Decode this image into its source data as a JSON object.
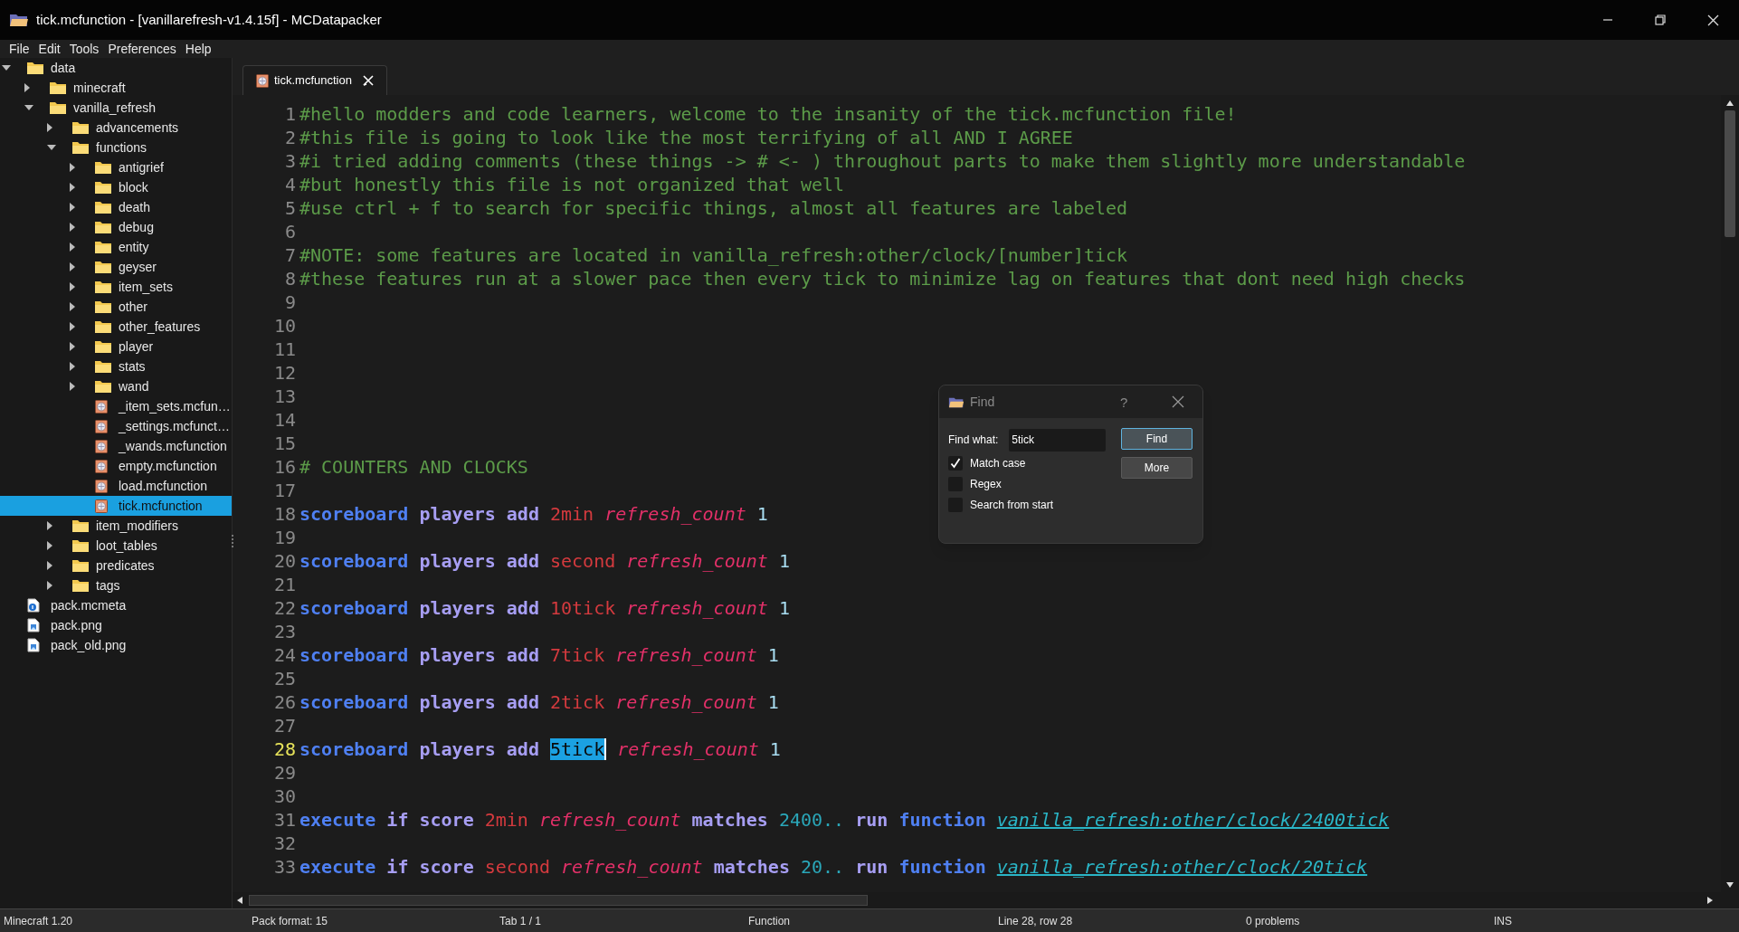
{
  "window": {
    "title": "tick.mcfunction - [vanillarefresh-v1.4.15f] - MCDatapacker"
  },
  "menu": [
    "File",
    "Edit",
    "Tools",
    "Preferences",
    "Help"
  ],
  "tree": [
    {
      "label": "data",
      "kind": "folder",
      "expanded": true,
      "selected": false,
      "children": [
        {
          "label": "minecraft",
          "kind": "folder",
          "expanded": false,
          "selected": false
        },
        {
          "label": "vanilla_refresh",
          "kind": "folder",
          "expanded": true,
          "selected": false,
          "children": [
            {
              "label": "advancements",
              "kind": "folder",
              "expanded": false,
              "selected": false
            },
            {
              "label": "functions",
              "kind": "folder",
              "expanded": true,
              "selected": false,
              "children": [
                {
                  "label": "antigrief",
                  "kind": "folder",
                  "expanded": false,
                  "selected": false
                },
                {
                  "label": "block",
                  "kind": "folder",
                  "expanded": false,
                  "selected": false
                },
                {
                  "label": "death",
                  "kind": "folder",
                  "expanded": false,
                  "selected": false
                },
                {
                  "label": "debug",
                  "kind": "folder",
                  "expanded": false,
                  "selected": false
                },
                {
                  "label": "entity",
                  "kind": "folder",
                  "expanded": false,
                  "selected": false
                },
                {
                  "label": "geyser",
                  "kind": "folder",
                  "expanded": false,
                  "selected": false
                },
                {
                  "label": "item_sets",
                  "kind": "folder",
                  "expanded": false,
                  "selected": false
                },
                {
                  "label": "other",
                  "kind": "folder",
                  "expanded": false,
                  "selected": false
                },
                {
                  "label": "other_features",
                  "kind": "folder",
                  "expanded": false,
                  "selected": false
                },
                {
                  "label": "player",
                  "kind": "folder",
                  "expanded": false,
                  "selected": false
                },
                {
                  "label": "stats",
                  "kind": "folder",
                  "expanded": false,
                  "selected": false
                },
                {
                  "label": "wand",
                  "kind": "folder",
                  "expanded": false,
                  "selected": false
                },
                {
                  "label": "_item_sets.mcfun…",
                  "kind": "function",
                  "selected": false
                },
                {
                  "label": "_settings.mcfunct…",
                  "kind": "function",
                  "selected": false
                },
                {
                  "label": "_wands.mcfunction",
                  "kind": "function",
                  "selected": false
                },
                {
                  "label": "empty.mcfunction",
                  "kind": "function",
                  "selected": false
                },
                {
                  "label": "load.mcfunction",
                  "kind": "function",
                  "selected": false
                },
                {
                  "label": "tick.mcfunction",
                  "kind": "function",
                  "selected": true
                }
              ]
            },
            {
              "label": "item_modifiers",
              "kind": "folder",
              "expanded": false,
              "selected": false
            },
            {
              "label": "loot_tables",
              "kind": "folder",
              "expanded": false,
              "selected": false
            },
            {
              "label": "predicates",
              "kind": "folder",
              "expanded": false,
              "selected": false
            },
            {
              "label": "tags",
              "kind": "folder",
              "expanded": false,
              "selected": false
            }
          ]
        }
      ]
    },
    {
      "label": "pack.mcmeta",
      "kind": "meta",
      "selected": false
    },
    {
      "label": "pack.png",
      "kind": "image",
      "selected": false
    },
    {
      "label": "pack_old.png",
      "kind": "image",
      "selected": false
    }
  ],
  "tabs": [
    {
      "label": "tick.mcfunction",
      "selected": true
    }
  ],
  "editor": {
    "lines": [
      {
        "n": "1",
        "current": false,
        "tokens": [
          {
            "kind": "comment",
            "t": "#hello modders and code learners, welcome to the insanity of the tick.mcfunction file!"
          }
        ]
      },
      {
        "n": "2",
        "current": false,
        "tokens": [
          {
            "kind": "comment",
            "t": "#this file is going to look like the most terrifying of all AND I AGREE"
          }
        ]
      },
      {
        "n": "3",
        "current": false,
        "tokens": [
          {
            "kind": "comment",
            "t": "#i tried adding comments (these things -> # <- ) throughout parts to make them slightly more understandable"
          }
        ]
      },
      {
        "n": "4",
        "current": false,
        "tokens": [
          {
            "kind": "comment",
            "t": "#but honestly this file is not organized that well"
          }
        ]
      },
      {
        "n": "5",
        "current": false,
        "tokens": [
          {
            "kind": "comment",
            "t": "#use ctrl + f to search for specific things, almost all features are labeled"
          }
        ]
      },
      {
        "n": "6",
        "current": false
      },
      {
        "n": "7",
        "current": false,
        "tokens": [
          {
            "kind": "comment",
            "t": "#NOTE: some features are located in vanilla_refresh:other/clock/[number]tick"
          }
        ]
      },
      {
        "n": "8",
        "current": false,
        "tokens": [
          {
            "kind": "comment",
            "t": "#these features run at a slower pace then every tick to minimize lag on features that dont need high checks"
          }
        ]
      },
      {
        "n": "9",
        "current": false
      },
      {
        "n": "10",
        "current": false
      },
      {
        "n": "11",
        "current": false
      },
      {
        "n": "12",
        "current": false
      },
      {
        "n": "13",
        "current": false
      },
      {
        "n": "14",
        "current": false
      },
      {
        "n": "15",
        "current": false
      },
      {
        "n": "16",
        "current": false,
        "tokens": [
          {
            "kind": "comment",
            "t": "# COUNTERS AND CLOCKS"
          }
        ]
      },
      {
        "n": "17",
        "current": false
      },
      {
        "n": "18",
        "current": false,
        "tokens": [
          {
            "kind": "keyword",
            "t": "scoreboard"
          },
          {
            "kind": "command",
            "t": "players"
          },
          {
            "kind": "command",
            "t": "add"
          },
          {
            "kind": "name",
            "t": "2min"
          },
          {
            "kind": "objective",
            "t": "refresh_count"
          },
          {
            "kind": "number",
            "t": "1"
          }
        ]
      },
      {
        "n": "19",
        "current": false
      },
      {
        "n": "20",
        "current": false,
        "tokens": [
          {
            "kind": "keyword",
            "t": "scoreboard"
          },
          {
            "kind": "command",
            "t": "players"
          },
          {
            "kind": "command",
            "t": "add"
          },
          {
            "kind": "name",
            "t": "second"
          },
          {
            "kind": "objective",
            "t": "refresh_count"
          },
          {
            "kind": "number",
            "t": "1"
          }
        ]
      },
      {
        "n": "21",
        "current": false
      },
      {
        "n": "22",
        "current": false,
        "tokens": [
          {
            "kind": "keyword",
            "t": "scoreboard"
          },
          {
            "kind": "command",
            "t": "players"
          },
          {
            "kind": "command",
            "t": "add"
          },
          {
            "kind": "name",
            "t": "10tick"
          },
          {
            "kind": "objective",
            "t": "refresh_count"
          },
          {
            "kind": "number",
            "t": "1"
          }
        ]
      },
      {
        "n": "23",
        "current": false
      },
      {
        "n": "24",
        "current": false,
        "tokens": [
          {
            "kind": "keyword",
            "t": "scoreboard"
          },
          {
            "kind": "command",
            "t": "players"
          },
          {
            "kind": "command",
            "t": "add"
          },
          {
            "kind": "name",
            "t": "7tick"
          },
          {
            "kind": "objective",
            "t": "refresh_count"
          },
          {
            "kind": "number",
            "t": "1"
          }
        ]
      },
      {
        "n": "25",
        "current": false
      },
      {
        "n": "26",
        "current": false,
        "tokens": [
          {
            "kind": "keyword",
            "t": "scoreboard"
          },
          {
            "kind": "command",
            "t": "players"
          },
          {
            "kind": "command",
            "t": "add"
          },
          {
            "kind": "name",
            "t": "2tick"
          },
          {
            "kind": "objective",
            "t": "refresh_count"
          },
          {
            "kind": "number",
            "t": "1"
          }
        ]
      },
      {
        "n": "27",
        "current": false
      },
      {
        "n": "28",
        "current": true,
        "tokens": [
          {
            "kind": "keyword",
            "t": "scoreboard"
          },
          {
            "kind": "command",
            "t": "players"
          },
          {
            "kind": "command",
            "t": "add"
          },
          {
            "kind": "match",
            "t": "5tick"
          },
          {
            "kind": "objective",
            "t": "refresh_count"
          },
          {
            "kind": "number",
            "t": "1"
          }
        ]
      },
      {
        "n": "29",
        "current": false
      },
      {
        "n": "30",
        "current": false
      },
      {
        "n": "31",
        "current": false,
        "tokens": [
          {
            "kind": "keyword",
            "t": "execute"
          },
          {
            "kind": "command",
            "t": "if"
          },
          {
            "kind": "command",
            "t": "score"
          },
          {
            "kind": "name",
            "t": "2min"
          },
          {
            "kind": "objective",
            "t": "refresh_count"
          },
          {
            "kind": "command",
            "t": "matches"
          },
          {
            "kind": "range",
            "t": "2400.."
          },
          {
            "kind": "command",
            "t": "run"
          },
          {
            "kind": "keyword",
            "t": "function"
          },
          {
            "kind": "path",
            "t": "vanilla_refresh:other/clock/2400tick"
          }
        ]
      },
      {
        "n": "32",
        "current": false
      },
      {
        "n": "33",
        "current": false,
        "tokens": [
          {
            "kind": "keyword",
            "t": "execute"
          },
          {
            "kind": "command",
            "t": "if"
          },
          {
            "kind": "command",
            "t": "score"
          },
          {
            "kind": "name",
            "t": "second"
          },
          {
            "kind": "objective",
            "t": "refresh_count"
          },
          {
            "kind": "command",
            "t": "matches"
          },
          {
            "kind": "range",
            "t": "20.."
          },
          {
            "kind": "command",
            "t": "run"
          },
          {
            "kind": "keyword",
            "t": "function"
          },
          {
            "kind": "path",
            "t": "vanilla_refresh:other/clock/20tick"
          }
        ]
      }
    ]
  },
  "find_dialog": {
    "title": "Find",
    "help": "?",
    "find_label": "Find what:",
    "find_value": "5tick",
    "buttons": [
      "Find",
      "More"
    ],
    "options": [
      {
        "label": "Match case",
        "checked": true
      },
      {
        "label": "Regex",
        "checked": false
      },
      {
        "label": "Search from start",
        "checked": false
      }
    ]
  },
  "status_bar": [
    "Minecraft 1.20",
    "Pack format: 15",
    "Tab 1 / 1",
    "Function",
    "Line 28, row 28",
    "0 problems",
    "INS"
  ]
}
